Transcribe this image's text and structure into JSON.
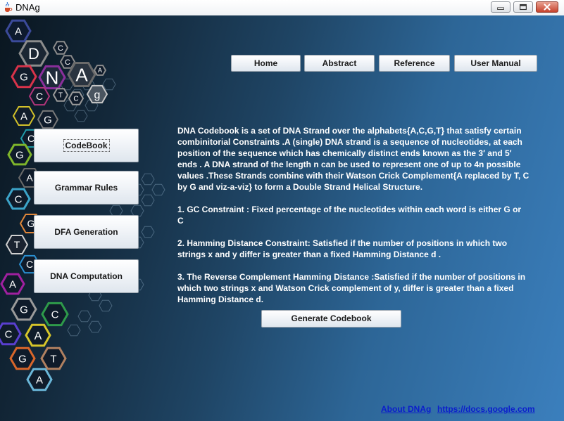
{
  "window": {
    "title": "DNAg",
    "icon": "java-cup-icon",
    "controls": [
      "minimize-icon",
      "maximize-icon",
      "close-icon"
    ]
  },
  "nav": {
    "home": "Home",
    "abstract": "Abstract",
    "reference": "Reference",
    "user_manual": "User Manual"
  },
  "side_menu": {
    "codebook": "CodeBook",
    "grammar_rules": "Grammar Rules",
    "dfa_generation": "DFA Generation",
    "dna_computation": "DNA Computation"
  },
  "description": {
    "intro": "DNA Codebook is a set of DNA Strand over the alphabets{A,C,G,T} that satisfy certain combinitorial Constraints .A (single) DNA strand is a sequence of nucleotides, at each position of the sequence which has chemically distinct ends known as the 3′ and 5′ ends . A DNA strand of the length n can be used to represent one of up to 4n possible values .These Strands combine with their Watson Crick Complement{A replaced by T, C by G and viz-a-viz} to form a Double Strand Helical Structure.",
    "constraint_1": "1. GC Constraint : Fixed percentage of the nucleotides within each word is either G or C",
    "constraint_2": "2. Hamming Distance Constraint: Satisfied if the number of positions in which two strings x and y differ is greater than a fixed Hamming Distance d .",
    "constraint_3": "3. The Reverse Complement Hamming Distance :Satisfied if the number of positions in which two strings x and Watson Crick complement of y, differ is greater than a fixed Hamming Distance d."
  },
  "generate_button": "Generate Codebook",
  "footer": {
    "about_link": "About DNAg ",
    "docs_link": "https://docs.google.com "
  },
  "logo": {
    "letters": [
      "A",
      "D",
      "C",
      "G",
      "C",
      "N",
      "A",
      "C",
      "T",
      "A",
      "C",
      "g",
      "A",
      "G",
      "C",
      "G",
      "A",
      "C",
      "G",
      "T",
      "C",
      "A",
      "G",
      "C",
      "C",
      "A",
      "G",
      "T",
      "A"
    ]
  },
  "colors": {
    "background_dark": "#0a1620",
    "background_light": "#3b7fbd",
    "link": "#0b1dcc",
    "text": "#ffffff"
  }
}
